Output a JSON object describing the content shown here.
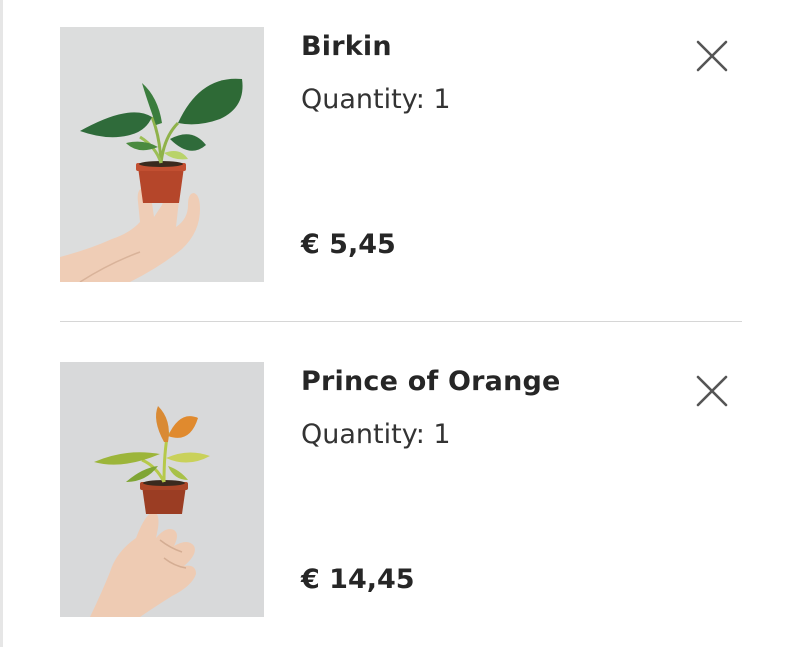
{
  "cart": {
    "items": [
      {
        "name": "Birkin",
        "quantity_label": "Quantity: 1",
        "price": "€ 5,45",
        "image_alt": "Birkin plant in hand",
        "remove_icon": "close-icon"
      },
      {
        "name": "Prince of Orange",
        "quantity_label": "Quantity: 1",
        "price": "€ 14,45",
        "image_alt": "Prince of Orange plant in hand",
        "remove_icon": "close-icon"
      }
    ]
  },
  "colors": {
    "text": "#262626",
    "divider": "#d6d6d6",
    "image_bg": "#d9dadb",
    "leaf_green": "#2f6b3a",
    "leaf_orange": "#e08a2e",
    "pot": "#b5462a"
  }
}
